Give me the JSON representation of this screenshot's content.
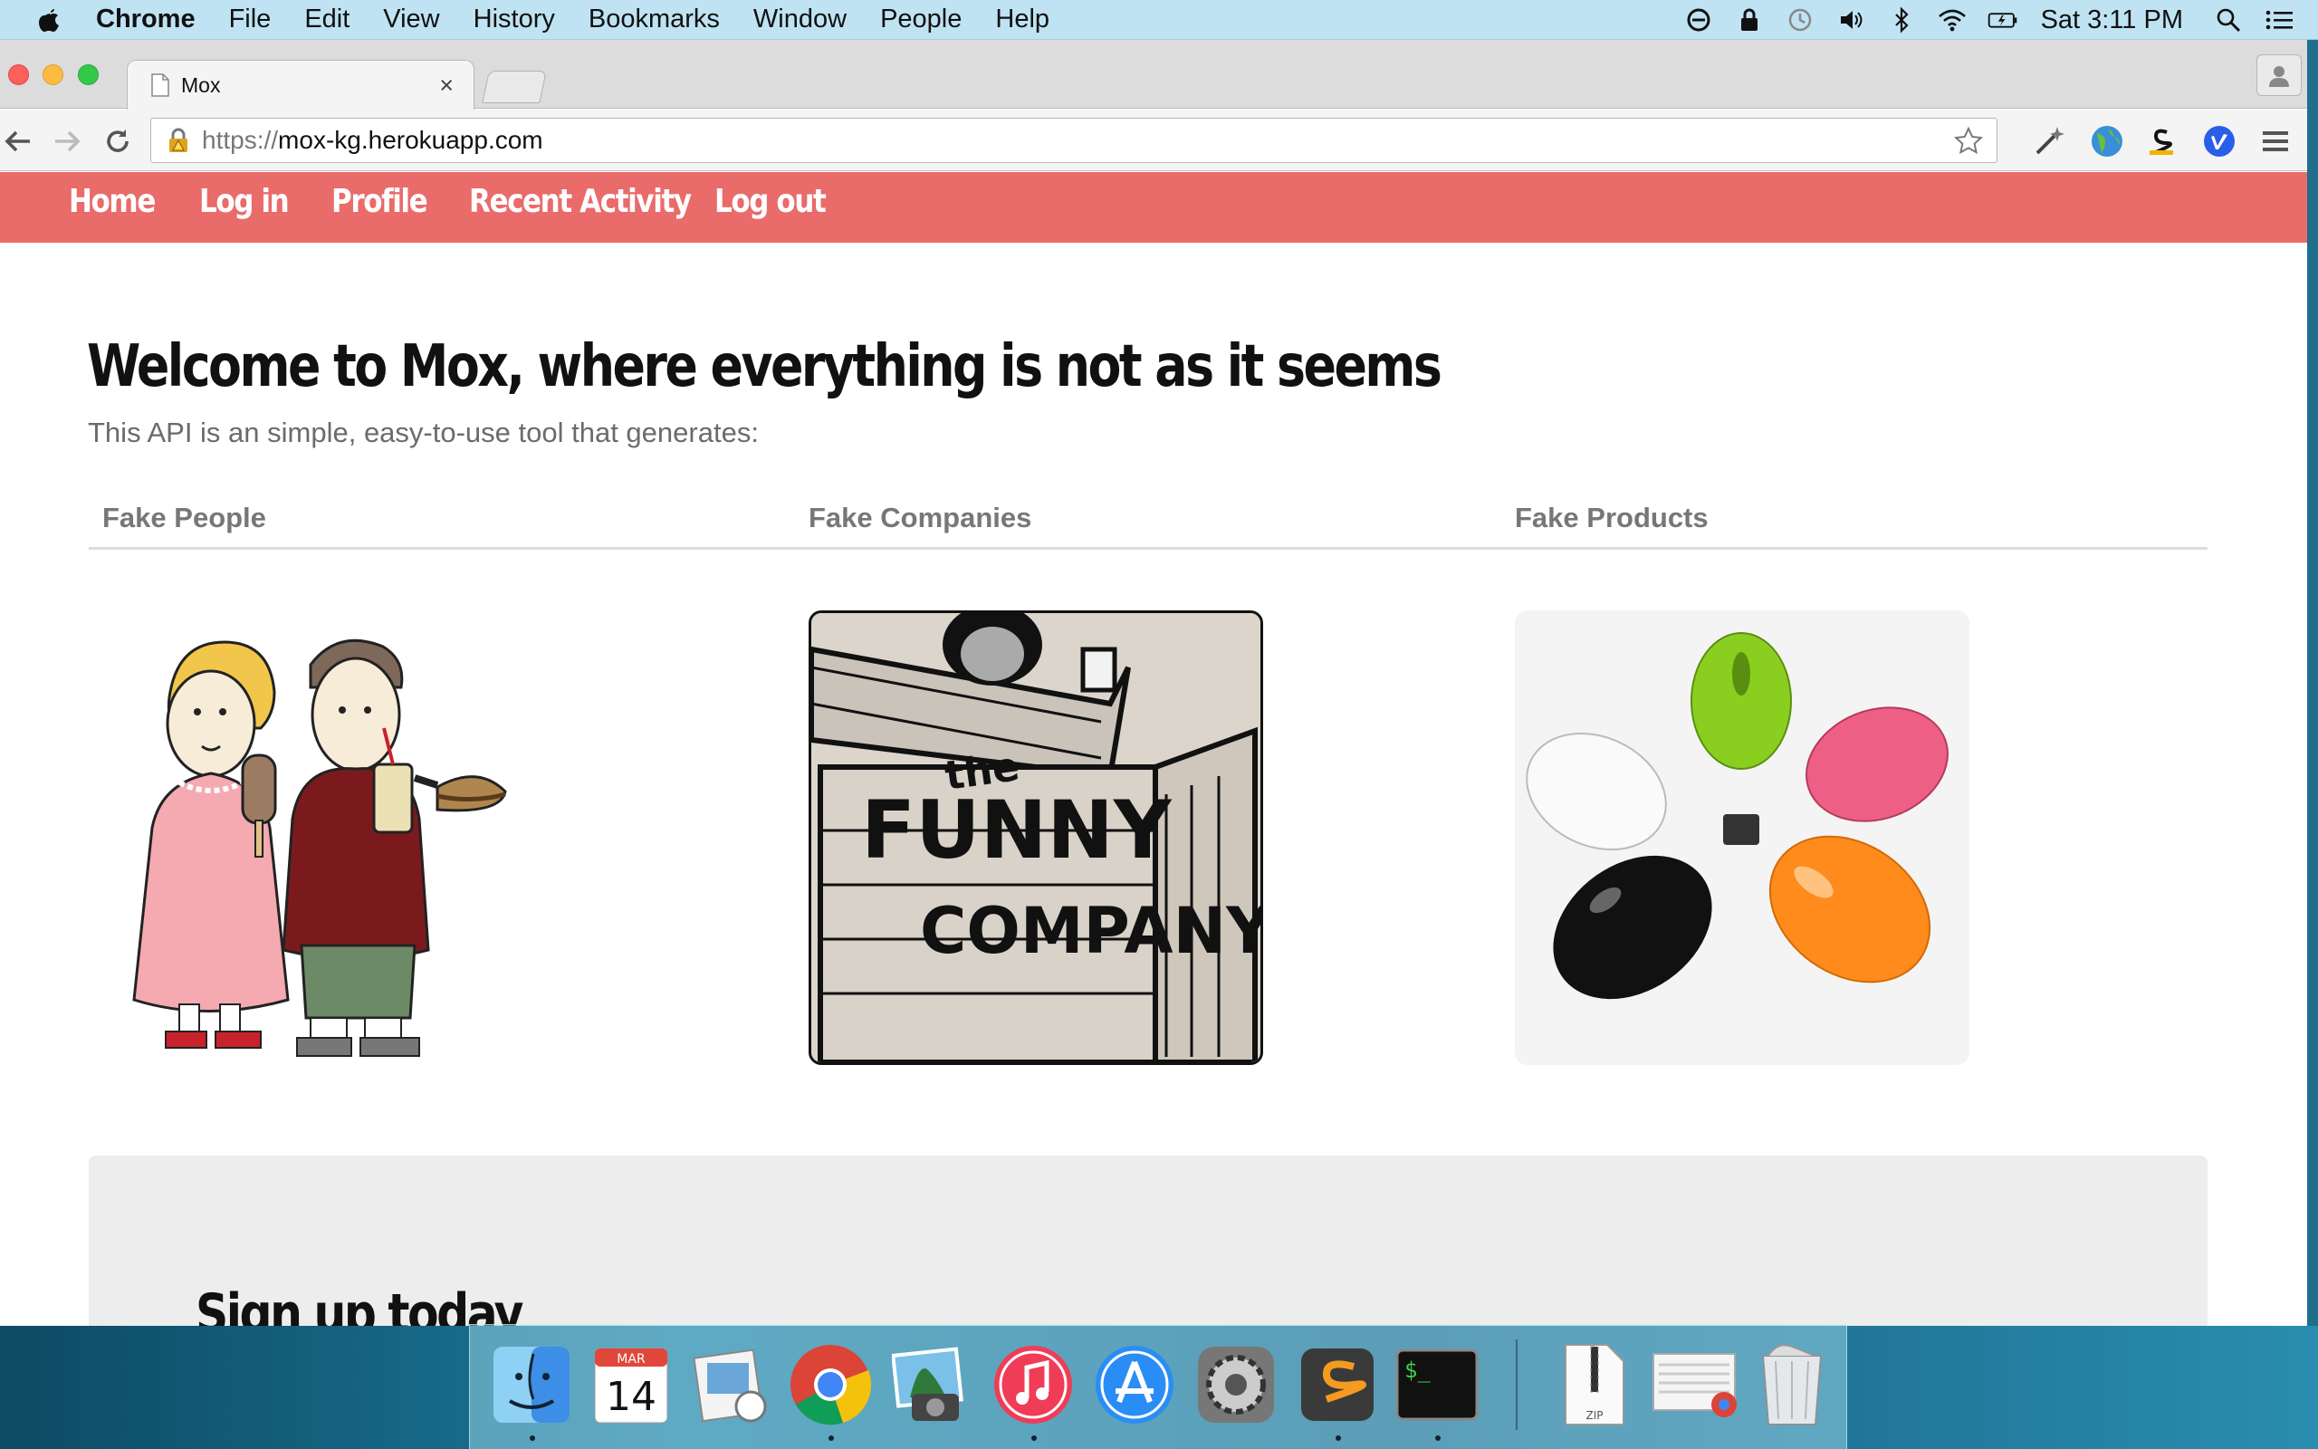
{
  "menubar": {
    "app_name": "Chrome",
    "menus": [
      "File",
      "Edit",
      "View",
      "History",
      "Bookmarks",
      "Window",
      "People",
      "Help"
    ],
    "clock": "Sat 3:11 PM",
    "status_icons": [
      "do-not-disturb-icon",
      "lock-icon",
      "time-machine-icon",
      "volume-icon",
      "bluetooth-icon",
      "wifi-icon",
      "battery-icon",
      "spotlight-icon",
      "notification-center-icon"
    ]
  },
  "browser": {
    "tab_title": "Mox",
    "tab_close": "×",
    "url_scheme": "https://",
    "url_host": "mox-kg.herokuapp.com",
    "extensions": [
      "wand-extension-icon",
      "globe-extension-icon",
      "s-extension-icon",
      "vimeo-extension-icon"
    ]
  },
  "site": {
    "nav": [
      "Home",
      "Log in",
      "Profile",
      "Recent Activity",
      "Log out"
    ],
    "headline": "Welcome to Mox, where everything is not as it seems",
    "intro": "This API is an simple, easy-to-use tool that generates:",
    "columns": [
      "Fake People",
      "Fake Companies",
      "Fake Products"
    ],
    "company_sign": [
      "the",
      "FUNNY",
      "COMPANY"
    ],
    "signup_heading": "Sign up today"
  },
  "dock": {
    "calendar_month": "MAR",
    "calendar_day": "14",
    "apps": [
      "finder",
      "calendar",
      "preview",
      "chrome",
      "iphoto",
      "itunes",
      "app-store",
      "system-preferences",
      "sublime-text",
      "terminal",
      "archive-zip",
      "chrome-downloads",
      "trash"
    ],
    "zip_label": "ZIP"
  },
  "colors": {
    "nav_bar": "#e96b6a",
    "menubar": "#bfe3f3"
  }
}
